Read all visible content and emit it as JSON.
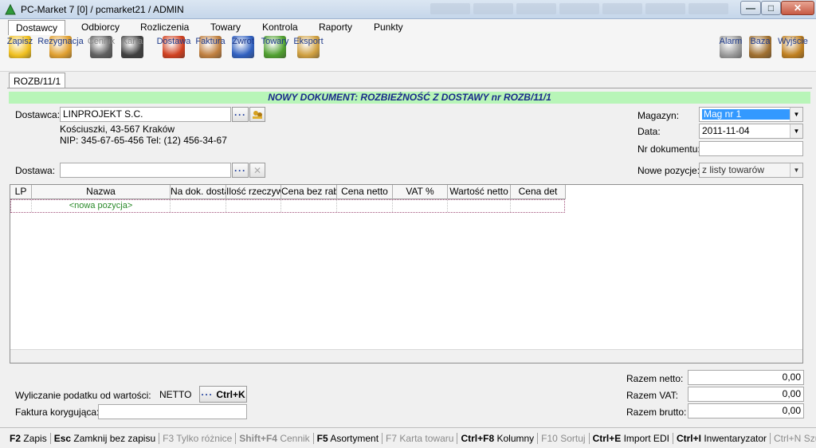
{
  "window": {
    "title": "PC-Market 7 [0] / pcmarket21 / ADMIN",
    "min_glyph": "—",
    "max_glyph": "□",
    "close_glyph": "✕"
  },
  "menu": [
    "Dostawcy",
    "Odbiorcy",
    "Rozliczenia",
    "Towary",
    "Kontrola",
    "Raporty",
    "Punkty"
  ],
  "toolbar": {
    "left": [
      {
        "label": "Zapisz",
        "icon": "save-icon",
        "enabled": true,
        "color": "#f0c020"
      },
      {
        "label": "Rezygnacja",
        "icon": "undo-icon",
        "enabled": true,
        "color": "#e0a030"
      },
      {
        "label": "Cennik",
        "icon": "price-list-icon",
        "enabled": false,
        "color": "#606060"
      },
      {
        "label": "Karta",
        "icon": "card-icon",
        "enabled": false,
        "color": "#404040"
      },
      {
        "label": "Dostawa",
        "icon": "delivery-icon",
        "enabled": true,
        "color": "#d04020"
      },
      {
        "label": "Faktura",
        "icon": "invoice-icon",
        "enabled": true,
        "color": "#c08040"
      },
      {
        "label": "Zwrot",
        "icon": "return-icon",
        "enabled": true,
        "color": "#3060c0"
      },
      {
        "label": "Towary",
        "icon": "goods-icon",
        "enabled": true,
        "color": "#50a030"
      },
      {
        "label": "Eksport",
        "icon": "export-icon",
        "enabled": true,
        "color": "#d0a040"
      }
    ],
    "right": [
      {
        "label": "Alarm",
        "icon": "alarm-icon",
        "color": "#9a9a9a"
      },
      {
        "label": "Baza",
        "icon": "database-icon",
        "color": "#a07030"
      },
      {
        "label": "Wyjście",
        "icon": "exit-icon",
        "color": "#c08020"
      }
    ]
  },
  "tab": "ROZB/11/1",
  "banner": "NOWY DOKUMENT: ROZBIEŻNOŚĆ Z DOSTAWY nr ROZB/11/1",
  "form": {
    "supplier_label": "Dostawca:",
    "supplier_value": "LINPROJEKT S.C.",
    "supplier_address": "Kościuszki, 43-567 Kraków",
    "supplier_nip": "NIP: 345-67-65-456 Tel: (12) 456-34-67",
    "delivery_label": "Dostawa:",
    "delivery_value": "",
    "warehouse_label": "Magazyn:",
    "warehouse_value": "Mag nr 1",
    "date_label": "Data:",
    "date_value": "2011-11-04",
    "docnum_label": "Nr dokumentu:",
    "docnum_value": "",
    "new_items_label": "Nowe pozycje:",
    "new_items_value": "z listy towarów",
    "dots": "···"
  },
  "grid": {
    "columns": [
      "LP",
      "Nazwa",
      "Na dok. dostawy",
      "Ilość rzeczywista",
      "Cena bez rabatu",
      "Cena netto",
      "VAT %",
      "Wartość netto",
      "Cena det"
    ],
    "new_row": "<nowa pozycja>"
  },
  "bottom": {
    "tax_label": "Wyliczanie podatku od wartości:",
    "tax_value": "NETTO",
    "tax_button": "Ctrl+K",
    "correcting_label": "Faktura korygująca:",
    "correcting_value": "",
    "net_label": "Razem netto:",
    "net_value": "0,00",
    "vat_label": "Razem VAT:",
    "vat_value": "0,00",
    "gross_label": "Razem brutto:",
    "gross_value": "0,00"
  },
  "statusbar": [
    {
      "key": "F2",
      "label": "Zapis",
      "enabled": true
    },
    {
      "key": "Esc",
      "label": "Zamknij bez zapisu",
      "enabled": true
    },
    {
      "key": "F3",
      "label": "Tylko różnice",
      "enabled": false
    },
    {
      "key": "Shift+F4",
      "label": "Cennik",
      "enabled": false
    },
    {
      "key": "F5",
      "label": "Asortyment",
      "enabled": true
    },
    {
      "key": "F7",
      "label": "Karta towaru",
      "enabled": false
    },
    {
      "key": "Ctrl+F8",
      "label": "Kolumny",
      "enabled": true
    },
    {
      "key": "F10",
      "label": "Sortuj",
      "enabled": false
    },
    {
      "key": "Ctrl+E",
      "label": "Import EDI",
      "enabled": true
    },
    {
      "key": "Ctrl+I",
      "label": "Inwentaryzator",
      "enabled": true
    },
    {
      "key": "Ctrl+N",
      "label": "Szuk",
      "enabled": false
    }
  ]
}
